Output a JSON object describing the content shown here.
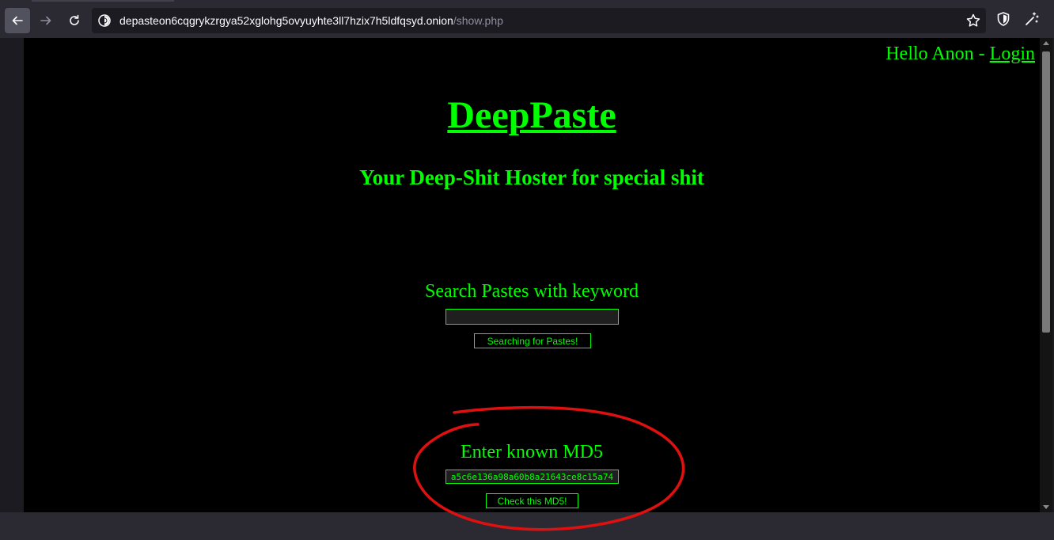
{
  "browser": {
    "url_host": "depasteon6cqgrykzrgya52xglohg5ovyuyhte3ll7hzix7h5ldfqsyd.onion",
    "url_path": "/show.php",
    "icons": [
      "back-arrow-icon",
      "forward-arrow-icon",
      "reload-icon",
      "onion-site-icon",
      "bookmark-star-icon",
      "shield-icon",
      "magic-wand-icon"
    ]
  },
  "header": {
    "greeting": "Hello Anon - ",
    "login_label": "Login"
  },
  "site": {
    "title": "DeepPaste",
    "tagline": "Your Deep-Shit Hoster for special shit"
  },
  "search": {
    "label": "Search Pastes with keyword",
    "value": "",
    "button_label": "Searching for Pastes!"
  },
  "md5": {
    "label": "Enter known MD5",
    "value": "a5c6e136a98a60b8a21643ce8c15a74",
    "button_label": "Check this MD5!"
  },
  "colors": {
    "text": "#00ff00",
    "background": "#000000",
    "annotation": "#e01010"
  }
}
